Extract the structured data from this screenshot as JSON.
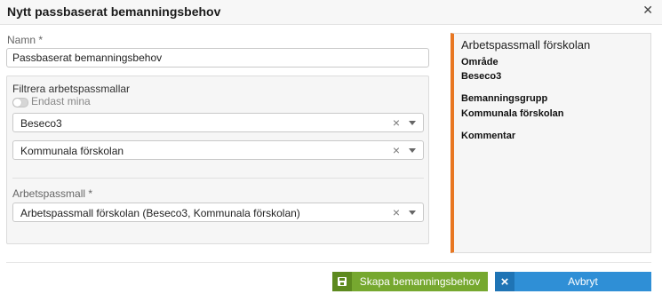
{
  "dialog": {
    "title": "Nytt passbaserat bemanningsbehov",
    "close_icon": "close-icon"
  },
  "form": {
    "name_label": "Namn *",
    "name_value": "Passbaserat bemanningsbehov",
    "filter": {
      "title": "Filtrera arbetspassmallar",
      "toggle_label": "Endast mina",
      "toggle_on": false,
      "area_select": "Beseco3",
      "group_select": "Kommunala förskolan"
    },
    "template_label": "Arbetspassmall *",
    "template_value": "Arbetspassmall förskolan (Beseco3, Kommunala förskolan)"
  },
  "info_panel": {
    "title": "Arbetspassmall förskolan",
    "area_label": "Område",
    "area_value": "Beseco3",
    "group_label": "Bemanningsgrupp",
    "group_value": "Kommunala förskolan",
    "comment_label": "Kommentar",
    "accent_color": "#e87722"
  },
  "footer": {
    "create_label": "Skapa bemanningsbehov",
    "create_icon": "save-icon",
    "create_color": "#76a82f",
    "cancel_label": "Avbryt",
    "cancel_icon": "close-icon",
    "cancel_color": "#2f8fd6"
  }
}
